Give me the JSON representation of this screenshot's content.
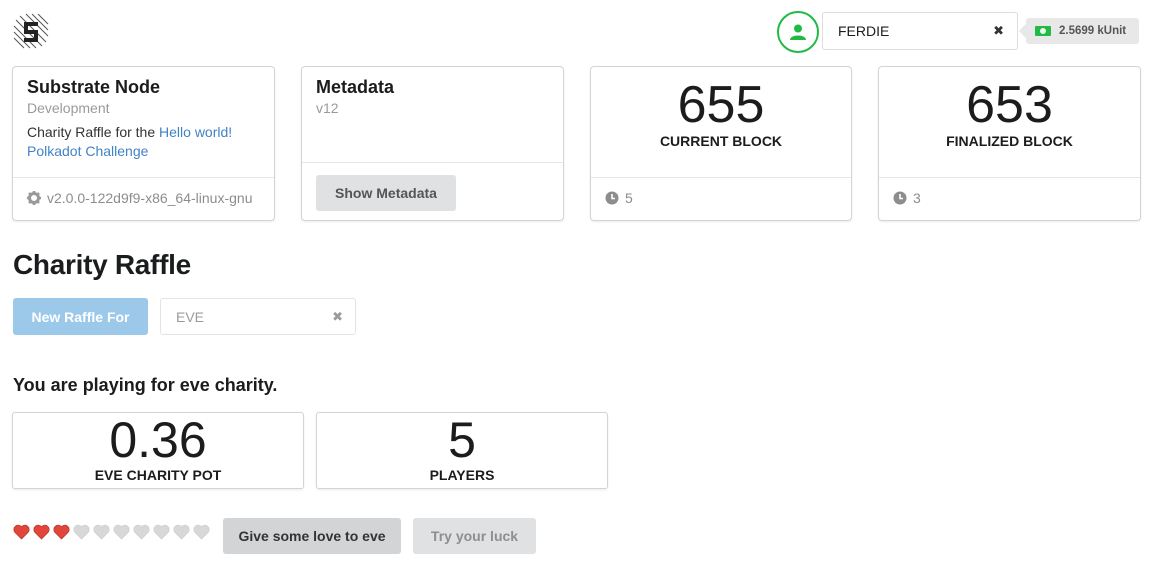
{
  "header": {
    "account_name": "FERDIE",
    "balance": "2.5699 kUnit",
    "clear_glyph": "✖",
    "icons": {
      "logo": "substrate-logo-icon",
      "avatar": "user-icon",
      "balance": "money-icon"
    },
    "colors": {
      "accent_green": "#21ba45"
    }
  },
  "cards": {
    "node": {
      "title": "Substrate Node",
      "subtitle": "Development",
      "desc_prefix": "Charity Raffle for the ",
      "desc_link": "Hello world! Polkadot Challenge",
      "version": "v2.0.0-122d9f9-x86_64-linux-gnu"
    },
    "metadata": {
      "title": "Metadata",
      "subtitle": "v12",
      "button": "Show Metadata"
    },
    "current_block": {
      "value": "655",
      "label": "CURRENT BLOCK",
      "footer": "5"
    },
    "finalized_block": {
      "value": "653",
      "label": "FINALIZED BLOCK",
      "footer": "3"
    }
  },
  "raffle": {
    "title": "Charity Raffle",
    "new_raffle_button": "New Raffle For",
    "charity_value": "EVE",
    "clear_glyph": "✖",
    "playing_text": "You are playing for eve charity.",
    "pot": {
      "value": "0.36",
      "label": "EVE CHARITY POT"
    },
    "players": {
      "value": "5",
      "label": "PLAYERS"
    },
    "hearts": {
      "filled": 3,
      "total": 10,
      "filled_color": "#e2453a",
      "empty_color": "#d8d8d8"
    },
    "love_button": "Give some love to eve",
    "luck_button": "Try your luck"
  }
}
